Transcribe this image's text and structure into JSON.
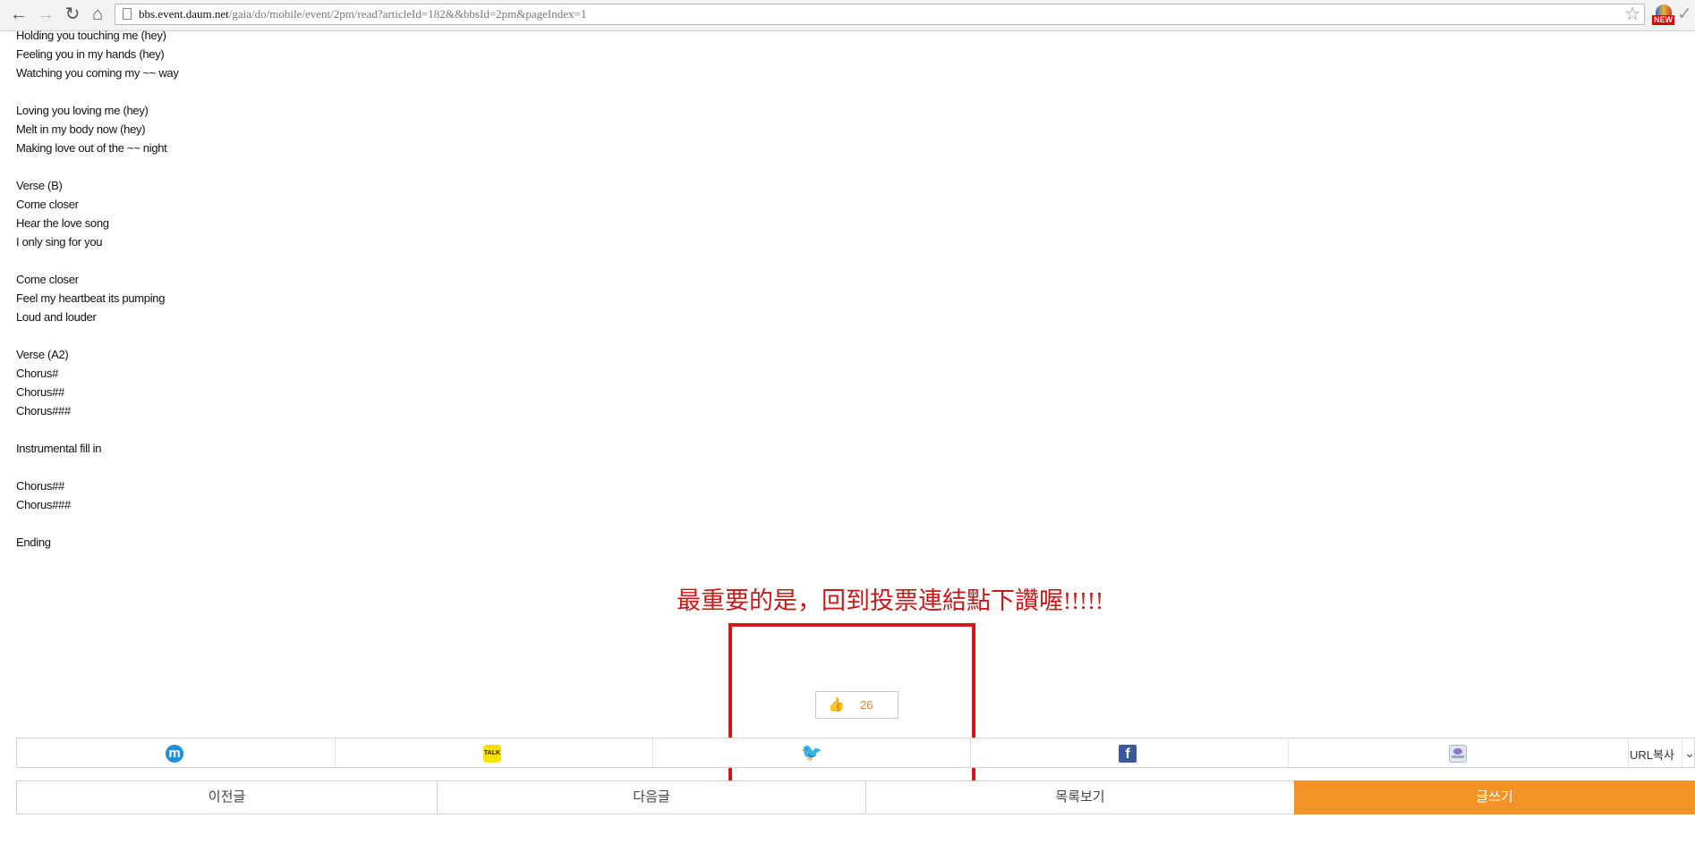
{
  "browser": {
    "url_host": "bbs.event.daum.net",
    "url_path": "/gaia/do/mobile/event/2pm/read?articleId=182&&bbsId=2pm&pageIndex=1",
    "ext_badge": "NEW"
  },
  "lyrics": [
    "Holding you touching me (hey)",
    "Feeling you in my hands (hey)",
    "Watching you coming my ~~ way",
    "",
    "Loving you loving me (hey)",
    "Melt in my body now (hey)",
    "Making love out of the ~~ night",
    "",
    "Verse (B)",
    "Come closer",
    "Hear the love song",
    "I only sing for you",
    "",
    "Come closer",
    "Feel my heartbeat its pumping",
    "Loud and louder",
    "",
    "Verse (A2)",
    "Chorus#",
    "Chorus##",
    "Chorus###",
    "",
    "Instrumental fill in",
    "",
    "Chorus##",
    "Chorus###",
    "",
    "Ending"
  ],
  "annotation": "最重要的是，回到投票連結點下讚喔!!!!!",
  "like": {
    "count": "26"
  },
  "share": {
    "icons": [
      "mypeople-icon",
      "kakaotalk-icon",
      "twitter-icon",
      "facebook-icon",
      "mail-icon"
    ],
    "url_copy": "URL복사"
  },
  "buttons": {
    "prev": "이전글",
    "next": "다음글",
    "list": "목록보기",
    "write": "글쓰기"
  },
  "colors": {
    "accent": "#f39227",
    "annotation": "#c61a1a",
    "highlight_box": "#d9151b"
  }
}
